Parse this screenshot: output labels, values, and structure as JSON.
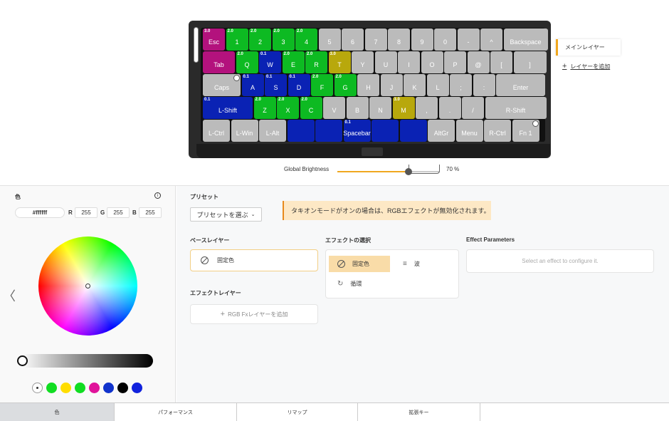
{
  "keyboard": {
    "rows": [
      [
        {
          "id": "esc",
          "label": "Esc",
          "tag": "3.0",
          "color": "magenta"
        },
        {
          "label": "1",
          "tag": "2.0",
          "color": "green"
        },
        {
          "label": "2",
          "tag": "2.0",
          "color": "green"
        },
        {
          "label": "3",
          "tag": "2.0",
          "color": "green"
        },
        {
          "label": "4",
          "tag": "2.0",
          "color": "green"
        },
        {
          "label": "5",
          "tag": "",
          "color": "gray"
        },
        {
          "label": "6",
          "tag": "",
          "color": "gray"
        },
        {
          "label": "7",
          "tag": "",
          "color": "gray"
        },
        {
          "label": "8",
          "tag": "",
          "color": "gray"
        },
        {
          "label": "9",
          "tag": "",
          "color": "gray"
        },
        {
          "label": "0",
          "tag": "",
          "color": "gray"
        },
        {
          "label": "-",
          "tag": "",
          "color": "gray"
        },
        {
          "label": "^",
          "tag": "",
          "color": "gray"
        },
        {
          "label": "Backspace",
          "tag": "",
          "color": "gray"
        }
      ],
      [
        {
          "label": "Tab",
          "tag": "",
          "color": "magenta"
        },
        {
          "label": "Q",
          "tag": "2.0",
          "color": "green"
        },
        {
          "label": "W",
          "tag": "0.1",
          "color": "blue"
        },
        {
          "label": "E",
          "tag": "2.0",
          "color": "green"
        },
        {
          "label": "R",
          "tag": "2.0",
          "color": "green"
        },
        {
          "label": "T",
          "tag": "3.0",
          "color": "yellow"
        },
        {
          "label": "Y",
          "tag": "",
          "color": "gray"
        },
        {
          "label": "U",
          "tag": "",
          "color": "gray"
        },
        {
          "label": "I",
          "tag": "",
          "color": "gray"
        },
        {
          "label": "O",
          "tag": "",
          "color": "gray"
        },
        {
          "label": "P",
          "tag": "",
          "color": "gray"
        },
        {
          "label": "@",
          "tag": "",
          "color": "gray"
        },
        {
          "label": "[",
          "tag": "",
          "color": "gray"
        },
        {
          "label": "]",
          "tag": "",
          "color": "gray"
        }
      ],
      [
        {
          "label": "Caps",
          "tag": "",
          "color": "gray",
          "knob": true
        },
        {
          "label": "A",
          "tag": "0.1",
          "color": "blue"
        },
        {
          "label": "S",
          "tag": "0.1",
          "color": "blue"
        },
        {
          "label": "D",
          "tag": "0.1",
          "color": "blue"
        },
        {
          "label": "F",
          "tag": "2.0",
          "color": "green"
        },
        {
          "label": "G",
          "tag": "2.0",
          "color": "green"
        },
        {
          "label": "H",
          "tag": "",
          "color": "gray"
        },
        {
          "label": "J",
          "tag": "",
          "color": "gray"
        },
        {
          "label": "K",
          "tag": "",
          "color": "gray"
        },
        {
          "label": "L",
          "tag": "",
          "color": "gray"
        },
        {
          "label": ";",
          "tag": "",
          "color": "gray"
        },
        {
          "label": ":",
          "tag": "",
          "color": "gray"
        },
        {
          "label": "Enter",
          "tag": "",
          "color": "gray"
        }
      ],
      [
        {
          "label": "L-Shift",
          "tag": "0.1",
          "color": "blue"
        },
        {
          "label": "Z",
          "tag": "2.0",
          "color": "green"
        },
        {
          "label": "X",
          "tag": "2.0",
          "color": "green"
        },
        {
          "label": "C",
          "tag": "2.0",
          "color": "green"
        },
        {
          "label": "V",
          "tag": "",
          "color": "gray"
        },
        {
          "label": "B",
          "tag": "",
          "color": "gray"
        },
        {
          "label": "N",
          "tag": "",
          "color": "gray"
        },
        {
          "label": "M",
          "tag": "3.0",
          "color": "yellow"
        },
        {
          "label": ",",
          "tag": "",
          "color": "gray"
        },
        {
          "label": ".",
          "tag": "",
          "color": "gray"
        },
        {
          "label": "/",
          "tag": "",
          "color": "gray"
        },
        {
          "label": "R-Shift",
          "tag": "",
          "color": "gray"
        }
      ],
      [
        {
          "label": "L-Ctrl",
          "tag": "",
          "color": "gray"
        },
        {
          "label": "L-Win",
          "tag": "",
          "color": "gray"
        },
        {
          "label": "L-Alt",
          "tag": "",
          "color": "gray"
        },
        {
          "label": "",
          "tag": "",
          "color": "blue"
        },
        {
          "label": "",
          "tag": "",
          "color": "blue"
        },
        {
          "label": "Spacebar",
          "tag": "0.1",
          "color": "blue"
        },
        {
          "label": "",
          "tag": "",
          "color": "blue"
        },
        {
          "label": "",
          "tag": "",
          "color": "blue"
        },
        {
          "label": "AltGr",
          "tag": "",
          "color": "gray"
        },
        {
          "label": "Menu",
          "tag": "",
          "color": "gray"
        },
        {
          "label": "R-Ctrl",
          "tag": "",
          "color": "gray"
        },
        {
          "label": "Fn 1",
          "tag": "",
          "color": "gray",
          "knob": true
        }
      ]
    ]
  },
  "layers": {
    "main": "メインレイヤー",
    "add": "レイヤーを追加",
    "add_icon": "plus-icon"
  },
  "brightness": {
    "label": "Global Brightness",
    "value": "70 %",
    "level_percent": 70
  },
  "color_panel": {
    "title": "色",
    "hex": "#ffffff",
    "r_label": "R",
    "r": "255",
    "g_label": "G",
    "g": "255",
    "b_label": "B",
    "b": "255",
    "swatches": [
      "#ffffff",
      "#11dd22",
      "#ffdd00",
      "#11dd22",
      "#e0139a",
      "#1133cc",
      "#000000",
      "#1122dd"
    ]
  },
  "presets": {
    "title": "プリセット",
    "button": "プリセットを選ぶ",
    "warning": "タキオンモードがオンの場合は、RGBエフェクトが無効化されます。"
  },
  "base_layer": {
    "title": "ベースレイヤー",
    "value": "固定色"
  },
  "effect_layer": {
    "title": "エフェクトレイヤー",
    "add": "RGB Fxレイヤーを追加"
  },
  "effect_select": {
    "title": "エフェクトの選択",
    "items": [
      "固定色",
      "波",
      "循環"
    ]
  },
  "effect_params": {
    "title": "Effect Parameters",
    "placeholder": "Select an effect to configure it."
  },
  "bottom_tabs": [
    "色",
    "パフォーマンス",
    "リマップ",
    "拡張キー"
  ]
}
